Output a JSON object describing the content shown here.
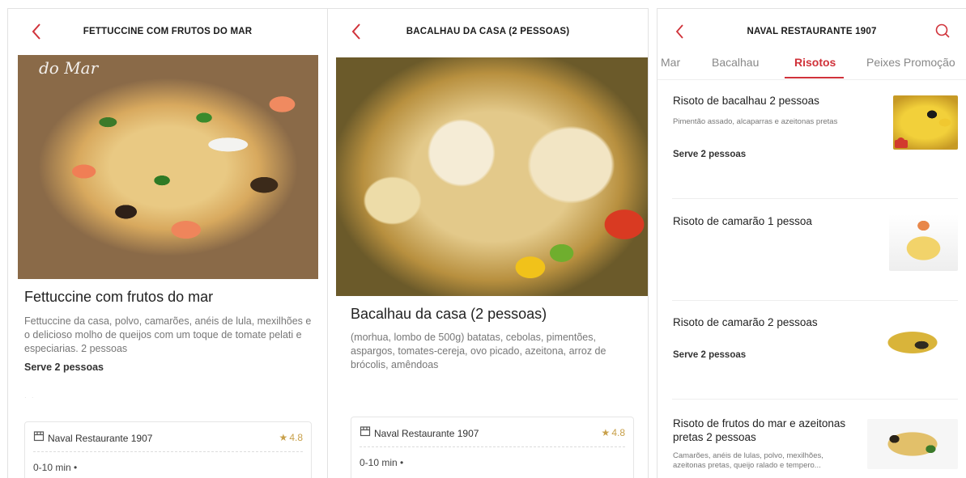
{
  "panel1": {
    "header_title": "FETTUCCINE COM FRUTOS DO MAR",
    "photo_watermark": "do Mar",
    "dish_title": "Fettuccine com frutos do mar",
    "dish_desc": "Fettuccine da casa, polvo, camarões, anéis de lula, mexilhões e o delicioso molho de queijos com um toque de tomate pelati e especiarias. 2 pessoas",
    "serve": "Serve 2 pessoas",
    "store_name": "Naval Restaurante 1907",
    "rating": "4.8",
    "eta": "0-10 min"
  },
  "panel2": {
    "header_title": "BACALHAU DA CASA (2 PESSOAS)",
    "dish_title": "Bacalhau da casa (2 pessoas)",
    "dish_desc": "(morhua, lombo de 500g) batatas, cebolas, pimentões, aspargos, tomates-cereja, ovo picado, azeitona, arroz de brócolis, amêndoas",
    "store_name": "Naval Restaurante 1907",
    "rating": "4.8",
    "eta": "0-10 min"
  },
  "panel3": {
    "header_title": "NAVAL RESTAURANTE 1907",
    "tabs": [
      {
        "label": "Mar"
      },
      {
        "label": "Bacalhau"
      },
      {
        "label": "Risotos"
      },
      {
        "label": "Peixes Promoção"
      }
    ],
    "items": [
      {
        "title": "Risoto de bacalhau 2 pessoas",
        "desc": "Pimentão assado, alcaparras e azeitonas pretas",
        "serve": "Serve 2 pessoas"
      },
      {
        "title": "Risoto de camarão 1 pessoa",
        "desc": "",
        "serve": ""
      },
      {
        "title": "Risoto de camarão 2 pessoas",
        "desc": "",
        "serve": "Serve 2 pessoas"
      },
      {
        "title": "Risoto de frutos do mar e azeitonas pretas 2 pessoas",
        "desc": "Camarões, anéis de lulas, polvo, mexilhões, azeitonas pretas, queijo ralado e tempero...",
        "serve": ""
      }
    ]
  },
  "colors": {
    "accent": "#d0323a",
    "rating": "#c8a04a"
  },
  "icons": {
    "back": "chevron-left-icon",
    "search": "search-icon",
    "store": "store-icon",
    "star": "star-icon"
  }
}
